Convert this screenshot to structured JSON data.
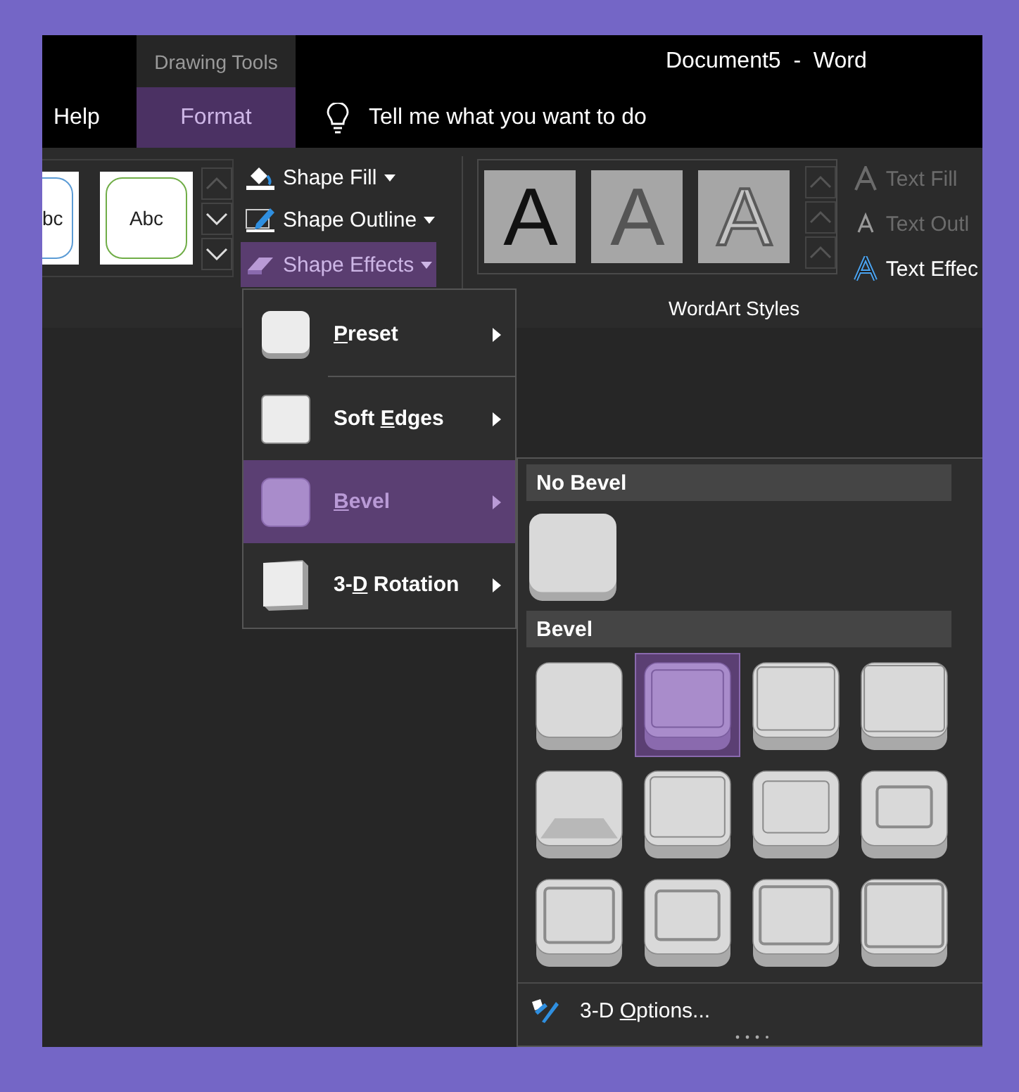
{
  "window": {
    "title": "Document5  -  Word",
    "context_tab": "Drawing Tools"
  },
  "tabs": [
    {
      "label": "Help",
      "selected": false
    },
    {
      "label": "Format",
      "selected": true
    }
  ],
  "tell_me": {
    "placeholder": "Tell me what you want to do"
  },
  "shape_styles": [
    {
      "text": "bc",
      "color": "#5b9bd5"
    },
    {
      "text": "Abc",
      "color": "#70ad47"
    }
  ],
  "shape_commands": [
    {
      "kind": "fill",
      "label": "Shape Fill",
      "selected": false
    },
    {
      "kind": "outline",
      "label": "Shape Outline",
      "selected": false
    },
    {
      "kind": "effects",
      "label": "Shape Effects",
      "selected": true
    }
  ],
  "wordart_styles": {
    "label": "WordArt Styles",
    "items": [
      {
        "kind": "solid",
        "text": "A"
      },
      {
        "kind": "soft",
        "text": "A"
      },
      {
        "kind": "outline",
        "text": "A"
      }
    ]
  },
  "text_commands": [
    {
      "kind": "fill",
      "label": "Text Fill",
      "disabled": true
    },
    {
      "kind": "outline",
      "label": "Text Outl",
      "disabled": true
    },
    {
      "kind": "effects",
      "label": "Text Effec",
      "disabled": false
    }
  ],
  "effects_menu": [
    {
      "kind": "preset",
      "label": {
        "key": "P",
        "post": "reset"
      },
      "selected": false
    },
    {
      "kind": "soft",
      "label": {
        "pre": "Soft ",
        "key": "E",
        "post": "dges"
      },
      "selected": false
    },
    {
      "kind": "bevel",
      "label": {
        "key": "B",
        "post": "evel"
      },
      "selected": true
    },
    {
      "kind": "rotation",
      "label": {
        "pre": "3-",
        "key": "D",
        "post": " Rotation"
      },
      "selected": false
    }
  ],
  "bevel_menu": {
    "no_bevel_heading": "No Bevel",
    "no_bevel": {
      "selected": false
    },
    "bevel_heading": "Bevel",
    "bevels": [
      {
        "selected": false
      },
      {
        "selected": true
      },
      {
        "selected": false
      },
      {
        "selected": false
      },
      {
        "selected": false
      },
      {
        "selected": false
      },
      {
        "selected": false
      },
      {
        "selected": false
      },
      {
        "selected": false
      },
      {
        "selected": false
      },
      {
        "selected": false
      },
      {
        "selected": false
      }
    ],
    "options": {
      "pre": "3-D ",
      "key": "O",
      "post": "ptions..."
    }
  }
}
